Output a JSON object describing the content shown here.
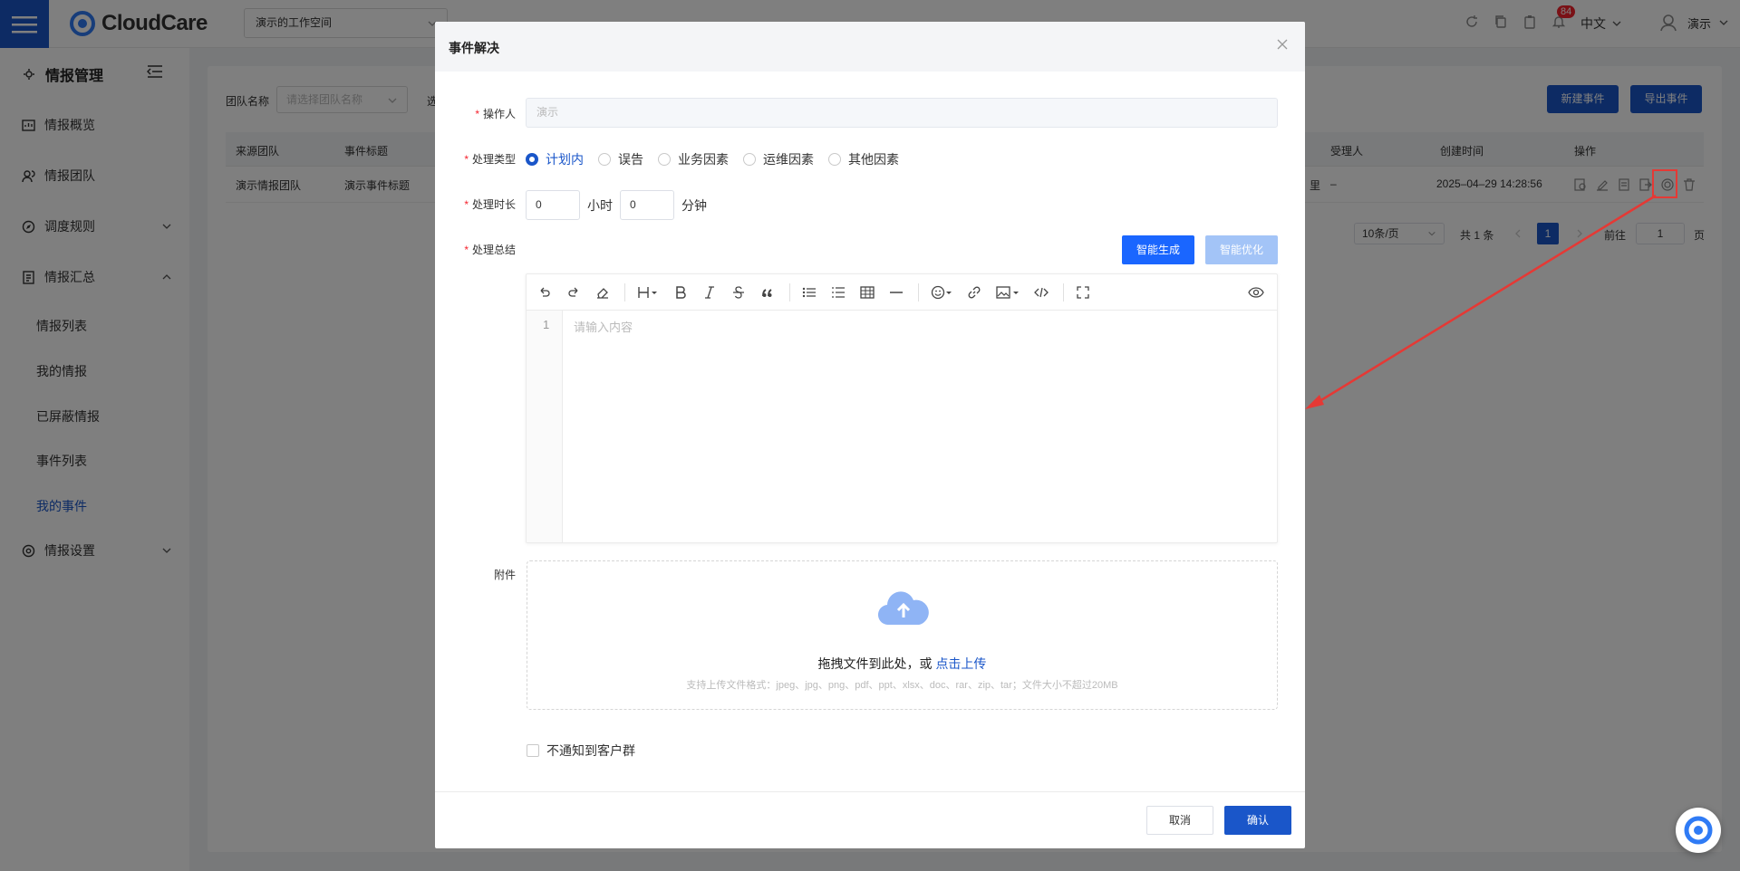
{
  "header": {
    "brand": "CloudCare",
    "workspace": "演示的工作空间",
    "notification_count": "84",
    "language": "中文",
    "user_name": "演示"
  },
  "sidebar": {
    "title": "情报管理",
    "items": [
      {
        "label": "情报概览",
        "icon": "overview-icon"
      },
      {
        "label": "情报团队",
        "icon": "team-icon"
      },
      {
        "label": "调度规则",
        "icon": "compass-icon"
      },
      {
        "label": "情报汇总",
        "icon": "document-icon"
      },
      {
        "label": "情报设置",
        "icon": "settings-icon"
      }
    ],
    "subitems": [
      "情报列表",
      "我的情报",
      "已屏蔽情报",
      "事件列表",
      "我的事件"
    ]
  },
  "main": {
    "team_label": "团队名称",
    "team_placeholder": "请选择团队名称",
    "cut_label": "选",
    "new_button": "新建事件",
    "export_button": "导出事件",
    "columns": [
      "来源团队",
      "事件标题",
      "受理人",
      "创建时间",
      "操作"
    ],
    "row": {
      "team": "演示情报团队",
      "title": "演示事件标题",
      "assignee": "–",
      "created": "2025–04–29 14:28:56",
      "cut_char": "里"
    },
    "pager": {
      "page_size": "10条/页",
      "total": "共 1 条",
      "current": "1",
      "goto_label": "前往",
      "goto_value": "1",
      "page_unit": "页"
    }
  },
  "dialog": {
    "title": "事件解决",
    "operator_label": "操作人",
    "operator_placeholder": "演示",
    "type_label": "处理类型",
    "types": [
      "计划内",
      "误告",
      "业务因素",
      "运维因素",
      "其他因素"
    ],
    "duration_label": "处理时长",
    "hours_value": "0",
    "hours_unit": "小时",
    "minutes_value": "0",
    "minutes_unit": "分钟",
    "summary_label": "处理总结",
    "gen_button": "智能生成",
    "opt_button": "智能优化",
    "editor_line": "1",
    "editor_placeholder": "请输入内容",
    "attachment_label": "附件",
    "upload_text": "拖拽文件到此处，或",
    "upload_link": "点击上传",
    "upload_hint": "支持上传文件格式：jpeg、jpg、png、pdf、ppt、xlsx、doc、rar、zip、tar；文件大小不超过20MB",
    "notify_label": "不通知到客户群",
    "cancel_button": "取消",
    "confirm_button": "确认"
  },
  "colors": {
    "primary": "#1a56c9",
    "accent": "#1a66ff",
    "annotation": "#e53935"
  }
}
